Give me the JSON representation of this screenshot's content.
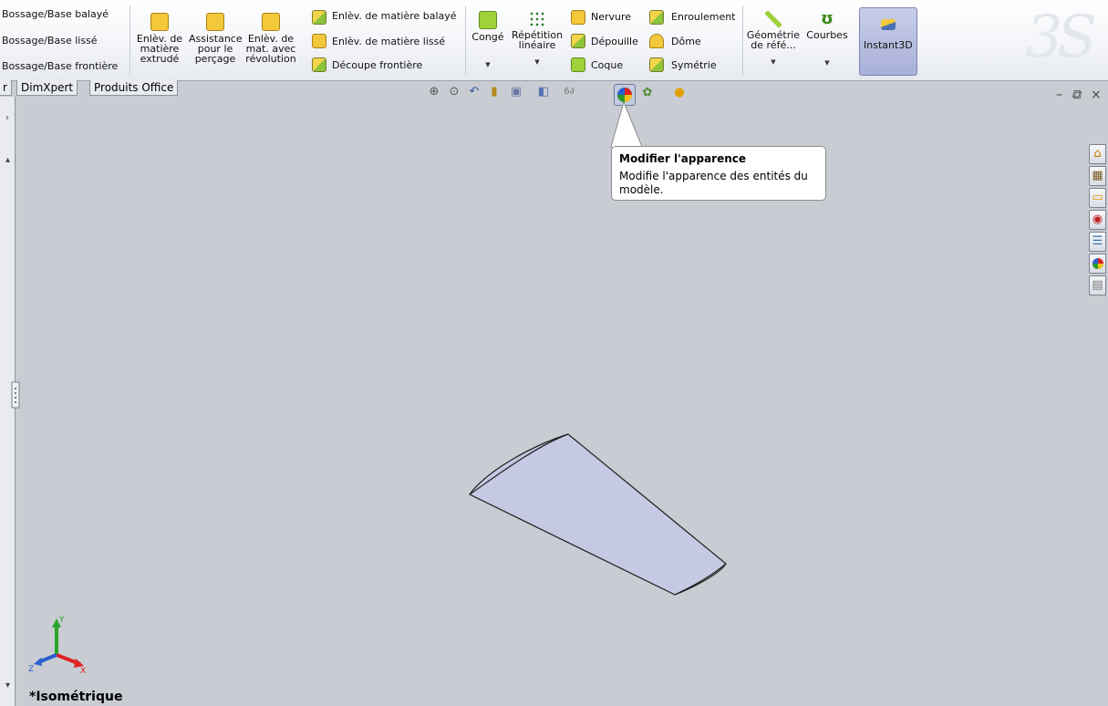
{
  "toolbar": {
    "bossage": {
      "balaye": "Bossage/Base balayé",
      "lisse": "Bossage/Base lissé",
      "frontiere": "Bossage/Base frontière"
    },
    "enlev_extrude": "Enlèv. de\nmatière\nextrudé",
    "assistance": "Assistance\npour le\nperçage",
    "enlev_revolution": "Enlèv. de\nmat. avec\nrévolution",
    "enlev_balaye": "Enlèv. de matière balayé",
    "enlev_lisse": "Enlèv. de matière lissé",
    "decoupe": "Découpe frontière",
    "conge": "Congé",
    "repetition": "Répétition\nlinéaire",
    "nervure": "Nervure",
    "depouille": "Dépouille",
    "coque": "Coque",
    "enroulement": "Enroulement",
    "dome": "Dôme",
    "symetrie": "Symétrie",
    "geometrie": "Géométrie\nde réfé...",
    "courbes": "Courbes",
    "instant3d": "Instant3D"
  },
  "tabs": [
    "r",
    "DimXpert",
    "Produits Office"
  ],
  "tooltip": {
    "title": "Modifier l'apparence",
    "description": "Modifie l'apparence des entités du modèle."
  },
  "view": {
    "orientation": "*Isométrique",
    "axes": {
      "x": "X",
      "y": "Y",
      "z": "Z"
    }
  },
  "colors": {
    "background": "#c9ccd2",
    "part_fill": "#c5c9e3",
    "accent": "#a9b0d8"
  }
}
